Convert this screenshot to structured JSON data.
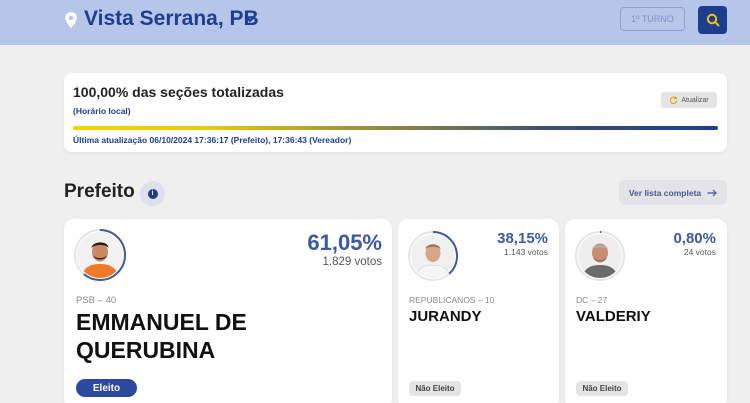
{
  "header": {
    "location": "Vista Serrana, PB",
    "turno_label": "1º TURNO"
  },
  "status": {
    "title": "100,00% das seções totalizadas",
    "subtitle": "(Horário local)",
    "refresh_label": "Atualizar",
    "progress_percent": 100,
    "last_update": "Última atualização 06/10/2024 17:36:17 (Prefeito), 17:36:43 (Vereador)"
  },
  "section": {
    "title": "Prefeito",
    "info_glyph": "i",
    "list_button_label": "Ver lista completa"
  },
  "candidates": [
    {
      "party": "PSB – 40",
      "name": "EMMANUEL DE QUERUBINA",
      "percent": "61,05%",
      "votes": "1.829 votos",
      "status": "Eleito",
      "percent_value": 61.05
    },
    {
      "party": "REPUBLICANOS – 10",
      "name": "JURANDY",
      "percent": "38,15%",
      "votes": "1.143 votos",
      "status": "Não Eleito",
      "percent_value": 38.15
    },
    {
      "party": "DC – 27",
      "name": "VALDERIY",
      "percent": "0,80%",
      "votes": "24 votos",
      "status": "Não Eleito",
      "percent_value": 0.8
    }
  ],
  "colors": {
    "header_bg": "#b6c5ea",
    "brand_blue": "#1f3d8f",
    "accent_yellow": "#f4d300",
    "ring_blue": "#3d5aa0"
  },
  "icons": {
    "location": "location-pin-icon",
    "chevron": "chevron-down-icon",
    "search": "search-icon",
    "refresh": "refresh-icon",
    "info": "info-icon",
    "arrow": "arrow-right-icon"
  }
}
